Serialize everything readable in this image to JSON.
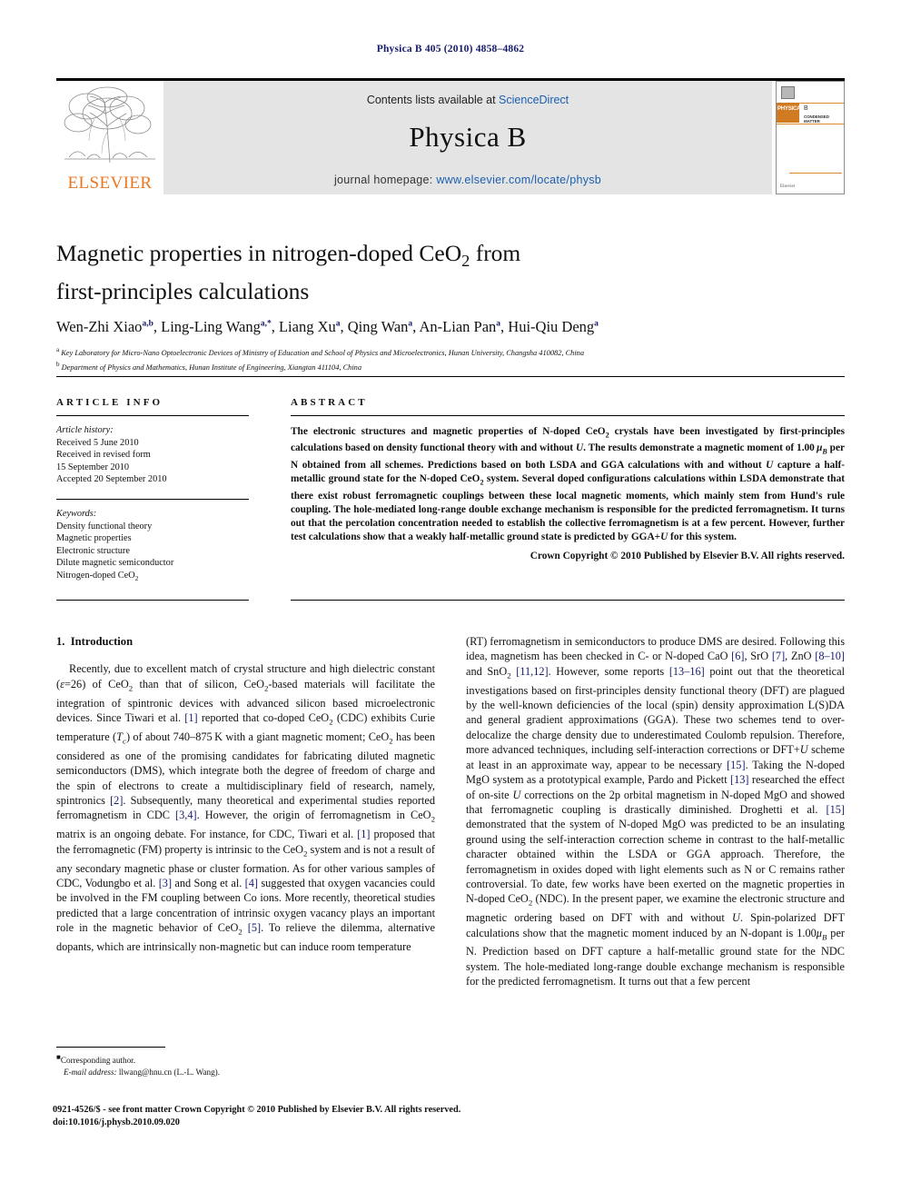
{
  "running_head": "Physica B 405 (2010) 4858–4862",
  "masthead": {
    "contents_prefix": "Contents lists available at ",
    "contents_link": "ScienceDirect",
    "journal_title": "Physica B",
    "homepage_prefix": "journal homepage: ",
    "homepage_url": "www.elsevier.com/locate/physb",
    "publisher_logo_text": "ELSEVIER",
    "cover": {
      "brand": "PHYSICA",
      "volume_letter": "B",
      "subtitle": "CONDENSED MATTER",
      "footer_logo": "Elsevier"
    }
  },
  "article": {
    "title_line1": "Magnetic properties in nitrogen-doped CeO",
    "title_line1_sub": "2",
    "title_line1_tail": " from",
    "title_line2": "first-principles calculations",
    "authors": [
      {
        "name": "Wen-Zhi Xiao",
        "marks": "a,b"
      },
      {
        "name": "Ling-Ling Wang",
        "marks": "a,*"
      },
      {
        "name": "Liang Xu",
        "marks": "a"
      },
      {
        "name": "Qing Wan",
        "marks": "a"
      },
      {
        "name": "An-Lian Pan",
        "marks": "a"
      },
      {
        "name": "Hui-Qiu Deng",
        "marks": "a"
      }
    ],
    "affiliations": [
      {
        "mark": "a",
        "text": "Key Laboratory for Micro-Nano Optoelectronic Devices of Ministry of Education and School of Physics and Microelectronics, Hunan University, Changsha 410082, China"
      },
      {
        "mark": "b",
        "text": "Department of Physics and Mathematics, Hunan Institute of Engineering, Xiangtan 411104, China"
      }
    ]
  },
  "info": {
    "heading": "ARTICLE INFO",
    "history_label": "Article history:",
    "history_lines": [
      "Received 5 June 2010",
      "Received in revised form",
      "15 September 2010",
      "Accepted 20 September 2010"
    ],
    "keywords_label": "Keywords:",
    "keywords": [
      "Density functional theory",
      "Magnetic properties",
      "Electronic structure",
      "Dilute magnetic semiconductor",
      "Nitrogen-doped CeO2"
    ]
  },
  "abstract": {
    "heading": "ABSTRACT",
    "body": "The electronic structures and magnetic properties of N-doped CeO2 crystals have been investigated by first-principles calculations based on density functional theory with and without U. The results demonstrate a magnetic moment of 1.00 μB per N obtained from all schemes. Predictions based on both LSDA and GGA calculations with and without U capture a half-metallic ground state for the N-doped CeO2 system. Several doped configurations calculations within LSDA demonstrate that there exist robust ferromagnetic couplings between these local magnetic moments, which mainly stem from Hund's rule coupling. The hole-mediated long-range double exchange mechanism is responsible for the predicted ferromagnetism. It turns out that the percolation concentration needed to establish the collective ferromagnetism is at a few percent. However, further test calculations show that a weakly half-metallic ground state is predicted by GGA+U for this system.",
    "copyright": "Crown Copyright © 2010 Published by Elsevier B.V. All rights reserved."
  },
  "body": {
    "section_number": "1.",
    "section_title": "Introduction",
    "left_paragraph": "Recently, due to excellent match of crystal structure and high dielectric constant (ε=26) of CeO2 than that of silicon, CeO2-based materials will facilitate the integration of spintronic devices with advanced silicon based microelectronic devices. Since Tiwari et al. [1] reported that co-doped CeO2 (CDC) exhibits Curie temperature (Tc) of about 740–875 K with a giant magnetic moment; CeO2 has been considered as one of the promising candidates for fabricating diluted magnetic semiconductors (DMS), which integrate both the degree of freedom of charge and the spin of electrons to create a multidisciplinary field of research, namely, spintronics [2]. Subsequently, many theoretical and experimental studies reported ferromagnetism in CDC [3,4]. However, the origin of ferromagnetism in CeO2 matrix is an ongoing debate. For instance, for CDC, Tiwari et al. [1] proposed that the ferromagnetic (FM) property is intrinsic to the CeO2 system and is not a result of any secondary magnetic phase or cluster formation. As for other various samples of CDC, Vodungbo et al. [3] and Song et al. [4] suggested that oxygen vacancies could be involved in the FM coupling between Co ions. More recently, theoretical studies predicted that a large concentration of intrinsic oxygen vacancy plays an important role in the magnetic behavior of CeO2 [5]. To relieve the dilemma, alternative dopants, which are intrinsically non-magnetic but can induce room temperature",
    "right_paragraph": "(RT) ferromagnetism in semiconductors to produce DMS are desired. Following this idea, magnetism has been checked in C- or N-doped CaO [6], SrO [7], ZnO [8–10] and SnO2 [11,12]. However, some reports [13–16] point out that the theoretical investigations based on first-principles density functional theory (DFT) are plagued by the well-known deficiencies of the local (spin) density approximation L(S)DA and general gradient approximations (GGA). These two schemes tend to over-delocalize the charge density due to underestimated Coulomb repulsion. Therefore, more advanced techniques, including self-interaction corrections or DFT+U scheme at least in an approximate way, appear to be necessary [15]. Taking the N-doped MgO system as a prototypical example, Pardo and Pickett [13] researched the effect of on-site U corrections on the 2p orbital magnetism in N-doped MgO and showed that ferromagnetic coupling is drastically diminished. Droghetti et al. [15] demonstrated that the system of N-doped MgO was predicted to be an insulating ground using the self-interaction correction scheme in contrast to the half-metallic character obtained within the LSDA or GGA approach. Therefore, the ferromagnetism in oxides doped with light elements such as N or C remains rather controversial. To date, few works have been exerted on the magnetic properties in N-doped CeO2 (NDC). In the present paper, we examine the electronic structure and magnetic ordering based on DFT with and without U. Spin-polarized DFT calculations show that the magnetic moment induced by an N-dopant is 1.00 μB per N. Prediction based on DFT capture a half-metallic ground state for the NDC system. The hole-mediated long-range double exchange mechanism is responsible for the predicted ferromagnetism. It turns out that a few percent"
  },
  "footnote": {
    "corresponding": "Corresponding author.",
    "email_label": "E-mail address:",
    "email": "llwang@hnu.cn (L.-L. Wang)."
  },
  "bottom": {
    "issn_line": "0921-4526/$ - see front matter Crown Copyright © 2010 Published by Elsevier B.V. All rights reserved.",
    "doi_line": "doi:10.1016/j.physb.2010.09.020"
  },
  "colors": {
    "link": "#1b5fae",
    "elsevier_orange": "#E87722",
    "reference_blue": "#151b6b"
  }
}
